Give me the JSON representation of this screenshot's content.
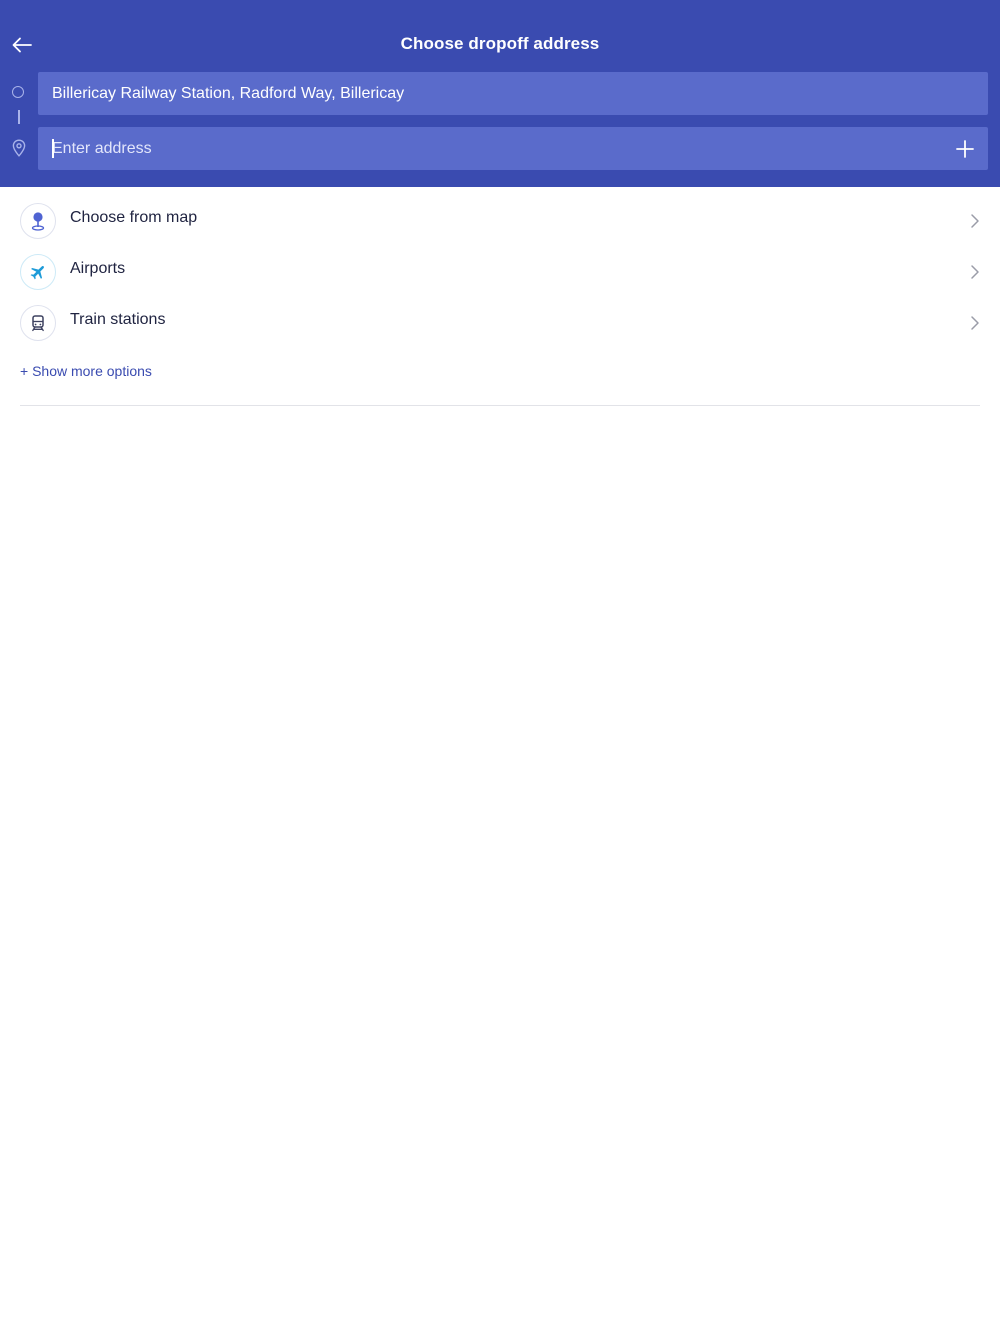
{
  "header": {
    "title": "Choose dropoff address",
    "background_color": "#3a4bb0",
    "field_color": "#5a6bcb"
  },
  "pickup": {
    "value": "Billericay Railway Station, Radford Way, Billericay"
  },
  "dropoff": {
    "placeholder": "Enter address",
    "value": ""
  },
  "options": [
    {
      "label": "Choose from map",
      "icon": "map-pin-icon"
    },
    {
      "label": "Airports",
      "icon": "airplane-icon"
    },
    {
      "label": "Train stations",
      "icon": "train-icon"
    }
  ],
  "more_options_label": "+ Show more options"
}
